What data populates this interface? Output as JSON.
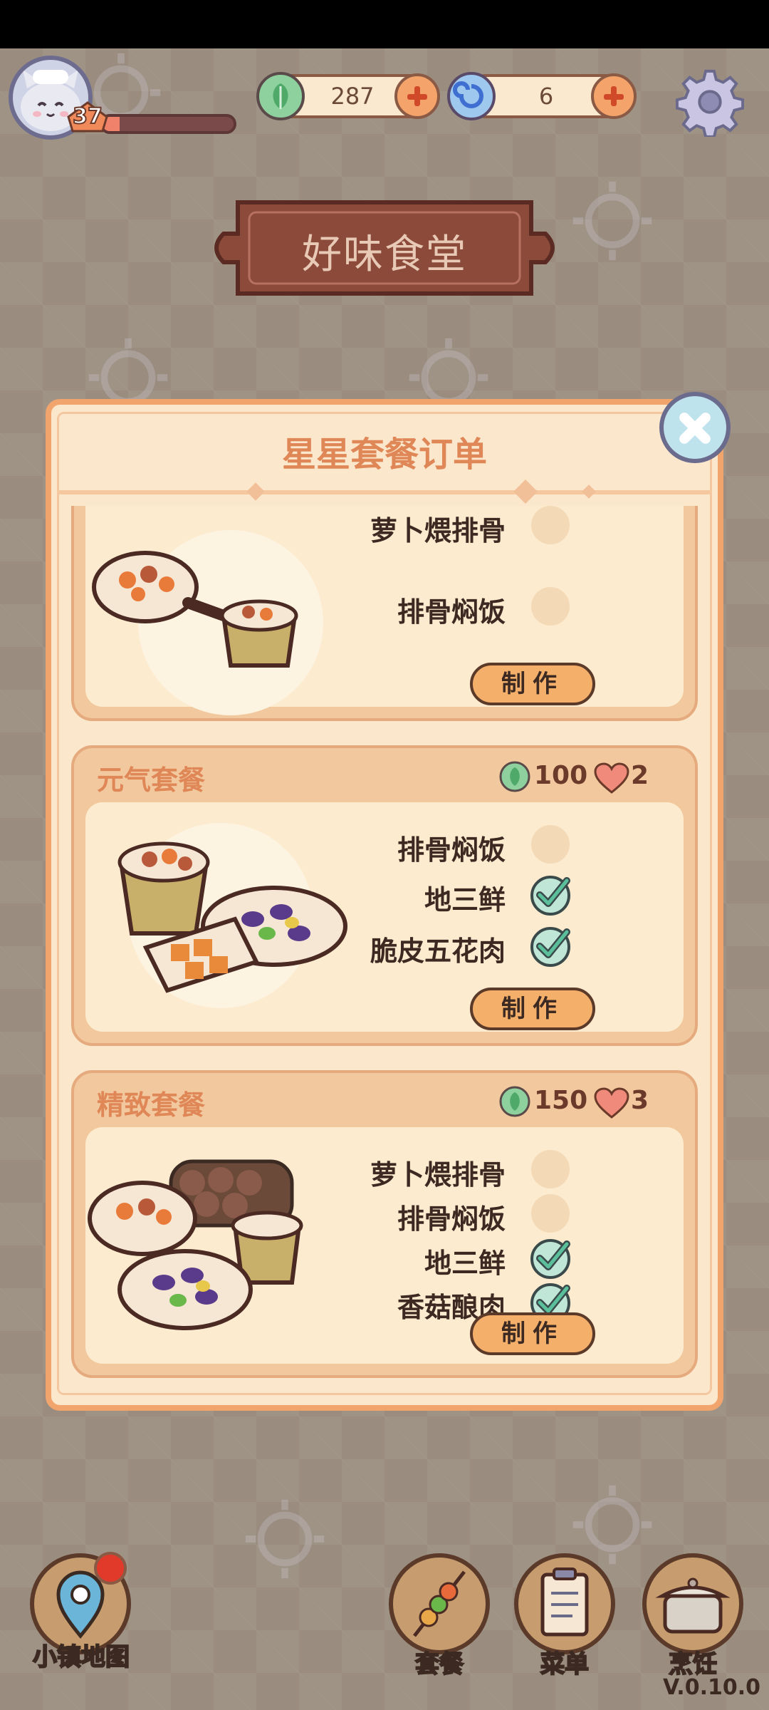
{
  "hud": {
    "level": "37",
    "xp_fraction": 0.13,
    "currency_leaf": "287",
    "currency_swirl": "6"
  },
  "sign": {
    "title": "好味食堂"
  },
  "panel": {
    "title": "星星套餐订单",
    "cards": [
      {
        "name": "",
        "dishes": [
          {
            "name": "萝卜煨排骨",
            "done": false
          },
          {
            "name": "排骨焖饭",
            "done": false
          }
        ],
        "button": "制作"
      },
      {
        "name": "元气套餐",
        "reward_leaf": "100",
        "reward_heart": "2",
        "dishes": [
          {
            "name": "排骨焖饭",
            "done": false
          },
          {
            "name": "地三鲜",
            "done": true
          },
          {
            "name": "脆皮五花肉",
            "done": true
          }
        ],
        "button": "制作"
      },
      {
        "name": "精致套餐",
        "reward_leaf": "150",
        "reward_heart": "3",
        "dishes": [
          {
            "name": "萝卜煨排骨",
            "done": false
          },
          {
            "name": "排骨焖饭",
            "done": false
          },
          {
            "name": "地三鲜",
            "done": true
          },
          {
            "name": "香菇酿肉",
            "done": true
          }
        ],
        "button": "制作"
      }
    ]
  },
  "nav": {
    "map": "小镇地图",
    "combo": "套餐",
    "menu": "菜单",
    "cook": "烹饪"
  },
  "version": "V.0.10.0",
  "colors": {
    "accent": "#e08758",
    "panel_bg": "#fbe7cb",
    "check_green": "#5bbf9c"
  }
}
